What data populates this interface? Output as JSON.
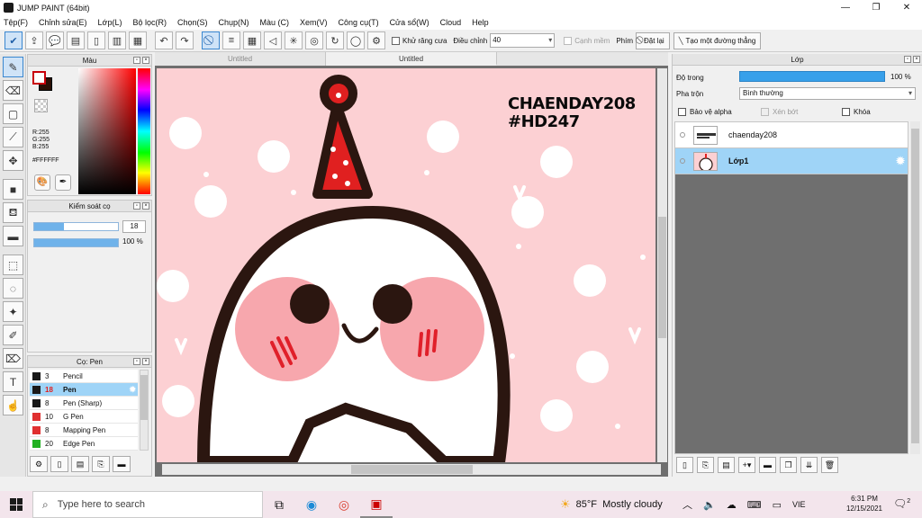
{
  "window": {
    "title": "JUMP PAINT (64bit)",
    "minimize": "—",
    "maximize": "❐",
    "close": "✕"
  },
  "menu": [
    "Tệp(F)",
    "Chỉnh sửa(E)",
    "Lớp(L)",
    "Bộ lọc(R)",
    "Chọn(S)",
    "Chụp(N)",
    "Màu (C)",
    "Xem(V)",
    "Công cụ(T)",
    "Cửa sổ(W)",
    "Cloud",
    "Help"
  ],
  "toolbar": {
    "antialias_label": "Khử răng cưa",
    "adjust_label": "Điều chỉnh",
    "adjust_value": "40",
    "smooth_label": "Cạnh mềm",
    "keys_label": "Phím",
    "reset_label": "Đặt lại",
    "straight_line_label": "Tạo một đường thẳng"
  },
  "color_panel": {
    "title": "Màu",
    "r": "R:255",
    "g": "G:255",
    "b": "B:255",
    "hex": "#FFFFFF",
    "fg_color": "#FFFFFF",
    "bg_color": "#2A0F05"
  },
  "brush_control": {
    "title": "Kiểm soát cọ",
    "size_value": "18",
    "size_fraction": 0.35,
    "opacity_value": "100 %",
    "opacity_fraction": 1.0
  },
  "brush_panel": {
    "title": "Cọ: Pen",
    "items": [
      {
        "size": "3",
        "name": "Pencil",
        "color": "#1a1a1a",
        "selected": false
      },
      {
        "size": "18",
        "name": "Pen",
        "color": "#1a1a1a",
        "selected": true
      },
      {
        "size": "8",
        "name": "Pen (Sharp)",
        "color": "#1a1a1a",
        "selected": false
      },
      {
        "size": "10",
        "name": "G Pen",
        "color": "#e03030",
        "selected": false
      },
      {
        "size": "8",
        "name": "Mapping Pen",
        "color": "#e03030",
        "selected": false
      },
      {
        "size": "20",
        "name": "Edge Pen",
        "color": "#22b022",
        "selected": false
      }
    ]
  },
  "documents": {
    "tabs": [
      "Untitled",
      "Untitled"
    ]
  },
  "canvas": {
    "text_line1": "CHAENDAY208",
    "text_line2": "#HD247",
    "background": "#FCD0D3"
  },
  "layer_panel": {
    "title": "Lớp",
    "opacity_label": "Độ trong",
    "opacity_value": "100 %",
    "blend_label": "Pha trộn",
    "blend_value": "Bình thường",
    "protect_alpha": "Bảo vệ alpha",
    "clipping": "Xén bớt",
    "lock": "Khóa",
    "layers": [
      {
        "name": "chaenday208",
        "selected": false
      },
      {
        "name": "Lớp1",
        "selected": true
      }
    ]
  },
  "taskbar": {
    "search_placeholder": "Type here to search",
    "weather_temp": "85°F",
    "weather_text": "Mostly cloudy",
    "lang": "VIE",
    "time": "6:31 PM",
    "date": "12/15/2021",
    "notif_count": "2"
  }
}
